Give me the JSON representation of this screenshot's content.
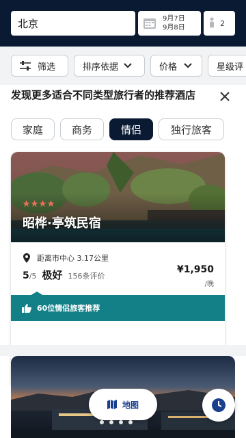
{
  "search": {
    "destination": "北京",
    "checkin": "9月7日",
    "checkout": "9月8日",
    "guests": "2"
  },
  "filters": [
    {
      "label": "筛选",
      "icon": "sliders-icon"
    },
    {
      "label": "排序依据",
      "icon": "chevron-down-icon"
    },
    {
      "label": "价格",
      "icon": "chevron-down-icon"
    },
    {
      "label": "星级评"
    }
  ],
  "recommend": {
    "title": "发现更多适合不同类型旅行者的推荐酒店",
    "tabs": [
      "家庭",
      "商务",
      "情侣",
      "独行旅客"
    ],
    "active_tab": "情侣"
  },
  "hotel": {
    "name": "昭桦·亭筑民宿",
    "stars": 4,
    "distance": "距离市中心 3.17公里",
    "score": "5",
    "score_scale": "/5",
    "rating_word": "极好",
    "reviews": "156条评价",
    "price": "¥1,950",
    "per_night": "/晚",
    "recommend_text": "60位情侣旅客推荐"
  },
  "carousel": {
    "active_fraction": 0.45
  },
  "map_button": {
    "label": "地图",
    "icon": "map-icon"
  },
  "colors": {
    "header": "#0a1a33",
    "accent": "#138088",
    "star": "#e8725a"
  }
}
